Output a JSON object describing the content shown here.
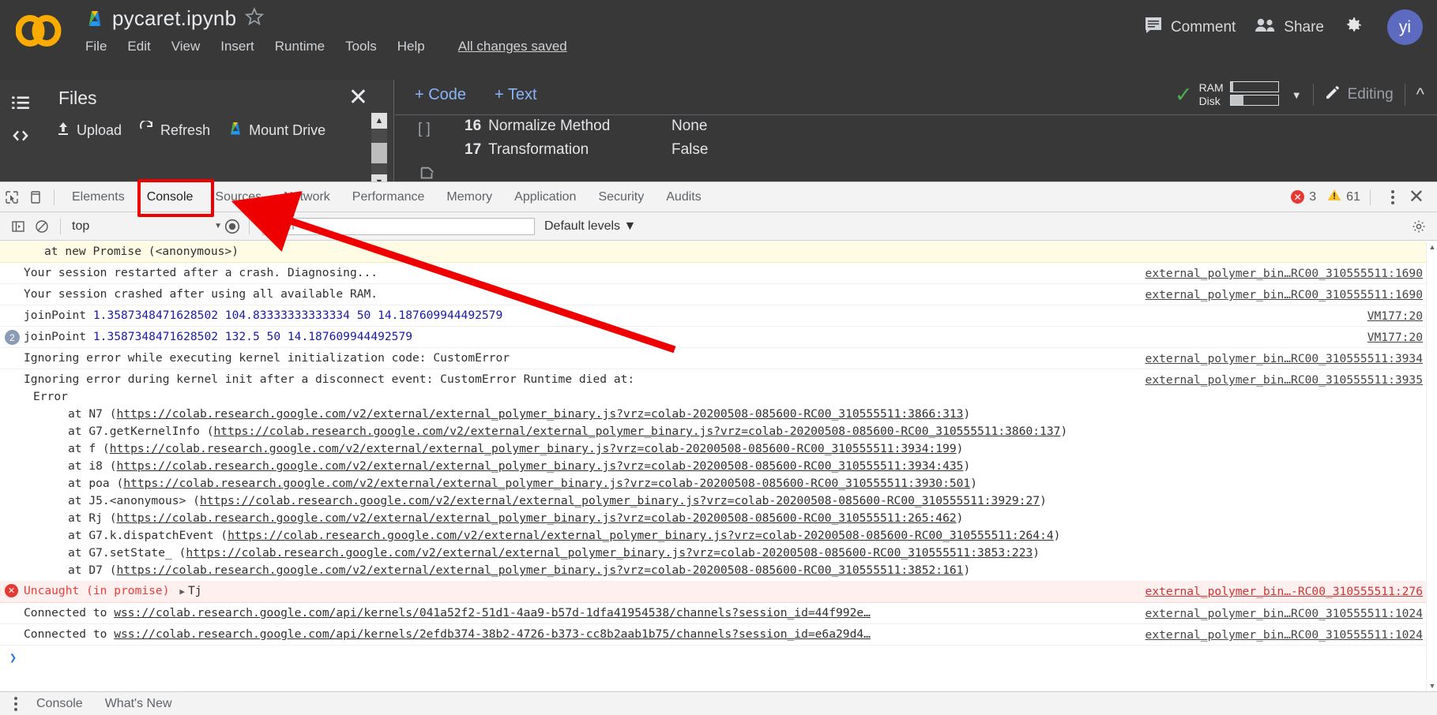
{
  "colab": {
    "notebook_title": "pycaret.ipynb",
    "menu": [
      "File",
      "Edit",
      "View",
      "Insert",
      "Runtime",
      "Tools",
      "Help"
    ],
    "save_status": "All changes saved",
    "comment_label": "Comment",
    "share_label": "Share",
    "avatar_initials": "yi",
    "files_panel": {
      "title": "Files",
      "actions": [
        "Upload",
        "Refresh",
        "Mount Drive"
      ],
      "close_label": "✕"
    },
    "toolbar": {
      "add_code": "+ Code",
      "add_text": "+ Text",
      "ram_label": "RAM",
      "disk_label": "Disk",
      "ram_fill_pct": 6,
      "disk_fill_pct": 28,
      "editing_label": "Editing"
    },
    "cells": {
      "gutter": "[ ]",
      "params": [
        {
          "index": "16",
          "name": "Normalize Method",
          "value": "None"
        },
        {
          "index": "17",
          "name": "Transformation",
          "value": "False"
        }
      ]
    }
  },
  "devtools": {
    "tabs": [
      "Elements",
      "Console",
      "Sources",
      "Network",
      "Performance",
      "Memory",
      "Application",
      "Security",
      "Audits"
    ],
    "active_tab": "Console",
    "error_count": "3",
    "warning_count": "61",
    "close_label": "✕",
    "filterbar": {
      "context": "top",
      "filter_placeholder": "Filter",
      "levels": "Default levels"
    },
    "statusbar": {
      "tabs": [
        "Console",
        "What's New"
      ]
    },
    "rows": [
      {
        "type": "warn",
        "indent": true,
        "text": "at new Promise (<anonymous>)",
        "source": ""
      },
      {
        "type": "info",
        "text": "Your session restarted after a crash. Diagnosing...",
        "source": "external_polymer_bin…RC00_310555511:1690"
      },
      {
        "type": "info",
        "text": "Your session crashed after using all available RAM.",
        "source": "external_polymer_bin…RC00_310555511:1690"
      },
      {
        "type": "numeric",
        "label": "joinPoint",
        "values": "1.3587348471628502 104.83333333333334 50 14.187609944492579",
        "source": "VM177:20"
      },
      {
        "type": "numeric",
        "badge": "2",
        "label": "joinPoint",
        "values": "1.3587348471628502 132.5 50 14.187609944492579",
        "source": "VM177:20"
      },
      {
        "type": "info",
        "text": "Ignoring error while executing kernel initialization code: CustomError",
        "source": "external_polymer_bin…RC00_310555511:3934"
      },
      {
        "type": "info",
        "text": "Ignoring error during kernel init after a disconnect event: CustomError Runtime died at:",
        "source": "external_polymer_bin…RC00_310555511:3935"
      }
    ],
    "stack_header": "Error",
    "stack": [
      {
        "fn": "at N7 (",
        "url": "https://colab.research.google.com/v2/external/external_polymer_binary.js?vrz=colab-20200508-085600-RC00_310555511:3866:313",
        "tail": ")"
      },
      {
        "fn": "at G7.getKernelInfo (",
        "url": "https://colab.research.google.com/v2/external/external_polymer_binary.js?vrz=colab-20200508-085600-RC00_310555511:3860:137",
        "tail": ")"
      },
      {
        "fn": "at f (",
        "url": "https://colab.research.google.com/v2/external/external_polymer_binary.js?vrz=colab-20200508-085600-RC00_310555511:3934:199",
        "tail": ")"
      },
      {
        "fn": "at i8 (",
        "url": "https://colab.research.google.com/v2/external/external_polymer_binary.js?vrz=colab-20200508-085600-RC00_310555511:3934:435",
        "tail": ")"
      },
      {
        "fn": "at poa (",
        "url": "https://colab.research.google.com/v2/external/external_polymer_binary.js?vrz=colab-20200508-085600-RC00_310555511:3930:501",
        "tail": ")"
      },
      {
        "fn": "at J5.<anonymous> (",
        "url": "https://colab.research.google.com/v2/external/external_polymer_binary.js?vrz=colab-20200508-085600-RC00_310555511:3929:27",
        "tail": ")"
      },
      {
        "fn": "at Rj (",
        "url": "https://colab.research.google.com/v2/external/external_polymer_binary.js?vrz=colab-20200508-085600-RC00_310555511:265:462",
        "tail": ")"
      },
      {
        "fn": "at G7.k.dispatchEvent (",
        "url": "https://colab.research.google.com/v2/external/external_polymer_binary.js?vrz=colab-20200508-085600-RC00_310555511:264:4",
        "tail": ")"
      },
      {
        "fn": "at G7.setState_ (",
        "url": "https://colab.research.google.com/v2/external/external_polymer_binary.js?vrz=colab-20200508-085600-RC00_310555511:3853:223",
        "tail": ")"
      },
      {
        "fn": "at D7 (",
        "url": "https://colab.research.google.com/v2/external/external_polymer_binary.js?vrz=colab-20200508-085600-RC00_310555511:3852:161",
        "tail": ")"
      }
    ],
    "uncaught": {
      "label": "Uncaught (in promise)",
      "object": "Tj",
      "source": "external_polymer_bin…-RC00_310555511:276"
    },
    "connections": [
      {
        "prefix": "Connected to ",
        "url": "wss://colab.research.google.com/api/kernels/041a52f2-51d1-4aa9-b57d-1dfa41954538/channels?session_id=44f992e…",
        "source": "external_polymer_bin…RC00_310555511:1024"
      },
      {
        "prefix": "Connected to ",
        "url": "wss://colab.research.google.com/api/kernels/2efdb374-38b2-4726-b373-cc8b2aab1b75/channels?session_id=e6a29d4…",
        "source": "external_polymer_bin…RC00_310555511:1024"
      }
    ]
  },
  "annotations": {
    "highlight_target": "Console",
    "arrow_color": "#ee0000"
  }
}
